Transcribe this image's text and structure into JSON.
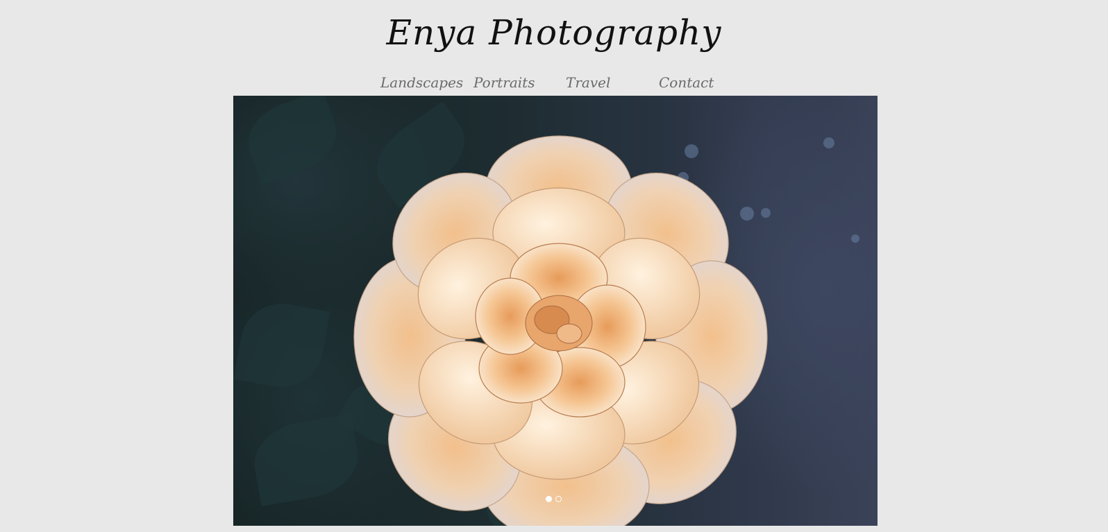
{
  "site": {
    "title": "Enya Photography"
  },
  "nav": {
    "items": [
      {
        "label": "Landscapes"
      },
      {
        "label": "Portraits"
      },
      {
        "label": "Travel"
      },
      {
        "label": "Contact"
      }
    ]
  },
  "slider": {
    "slide_count": 2,
    "active_index": 0
  },
  "colors": {
    "background": "#e8e8e8",
    "title": "#111111",
    "nav_text": "#6a6a6a",
    "rose_petal": "#f4cfa6"
  }
}
